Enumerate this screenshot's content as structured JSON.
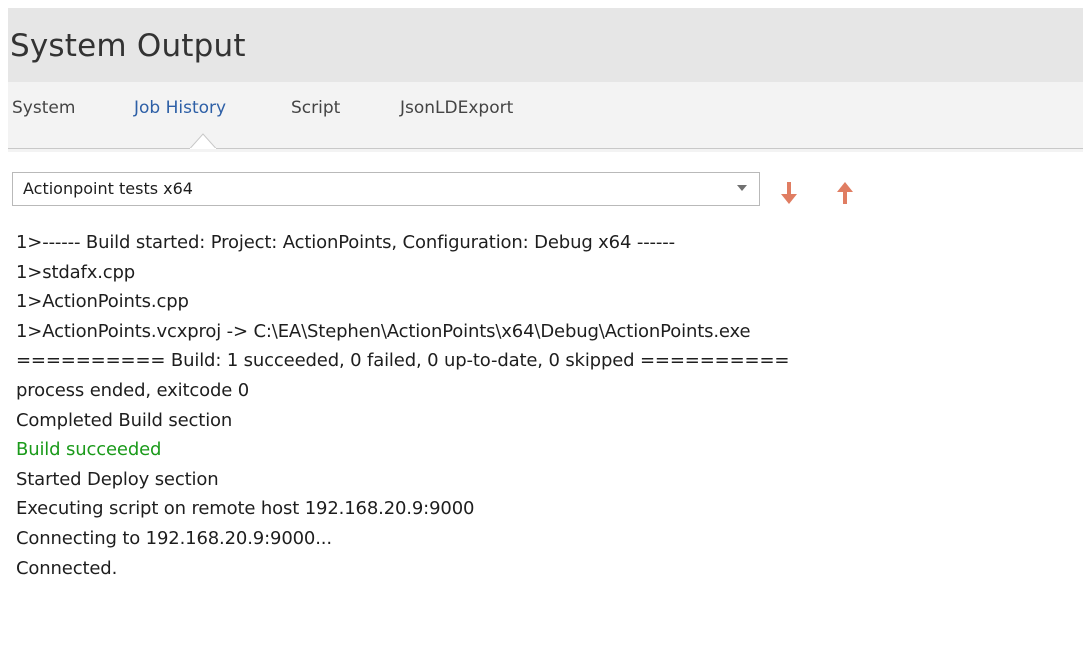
{
  "panel": {
    "title": "System Output"
  },
  "tabs": [
    {
      "label": "System",
      "active": false
    },
    {
      "label": "Job History",
      "active": true
    },
    {
      "label": "Script",
      "active": false
    },
    {
      "label": "JsonLDExport",
      "active": false
    }
  ],
  "toolbar": {
    "job_select_value": "Actionpoint tests x64",
    "move_down_icon": "arrow-down-icon",
    "move_up_icon": "arrow-up-icon"
  },
  "output": {
    "lines": [
      "1>------ Build started: Project: ActionPoints, Configuration: Debug x64 ------",
      "1>stdafx.cpp",
      "1>ActionPoints.cpp",
      "1>ActionPoints.vcxproj -> C:\\EA\\Stephen\\ActionPoints\\x64\\Debug\\ActionPoints.exe",
      "========== Build: 1 succeeded, 0 failed, 0 up-to-date, 0 skipped ==========",
      "process ended, exitcode 0",
      "Completed Build section",
      "Build succeeded",
      "Started Deploy section",
      "Executing script on remote host 192.168.20.9:9000",
      "Connecting to 192.168.20.9:9000...",
      "Connected."
    ],
    "success_line_color": "#1a9a1a"
  },
  "colors": {
    "accent_tab": "#2d5fa6",
    "arrow_icons": "#e07d62",
    "title_background": "#e6e6e6",
    "tab_background": "#f3f3f3"
  }
}
